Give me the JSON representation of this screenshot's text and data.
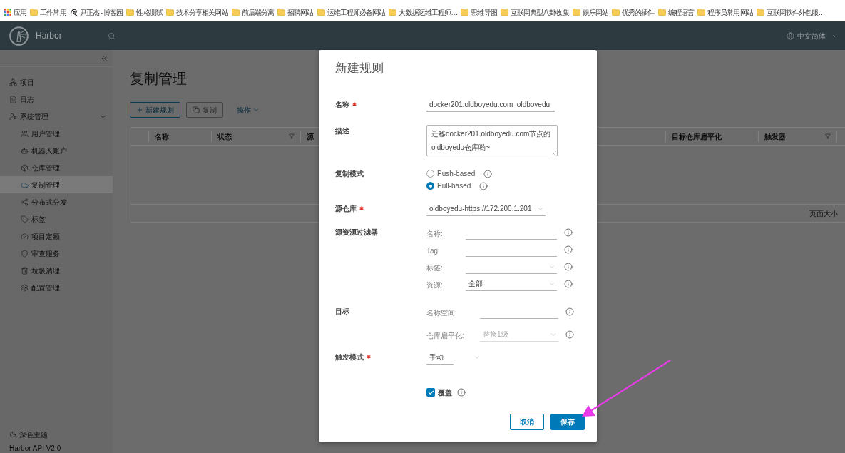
{
  "bookmarks": [
    {
      "label": "应用",
      "kind": "apps"
    },
    {
      "label": "工作常用",
      "kind": "folder"
    },
    {
      "label": "尹正杰 - 博客园",
      "kind": "site"
    },
    {
      "label": "性格测试",
      "kind": "folder"
    },
    {
      "label": "技术分享相关网站",
      "kind": "folder"
    },
    {
      "label": "前后端分离",
      "kind": "folder"
    },
    {
      "label": "招聘网站",
      "kind": "folder"
    },
    {
      "label": "运维工程师必备网站",
      "kind": "folder"
    },
    {
      "label": "大数据运维工程师…",
      "kind": "folder"
    },
    {
      "label": "思维导图",
      "kind": "folder"
    },
    {
      "label": "互联网典型八卦收集",
      "kind": "folder"
    },
    {
      "label": "娱乐网站",
      "kind": "folder"
    },
    {
      "label": "优秀的插件",
      "kind": "folder"
    },
    {
      "label": "编程语言",
      "kind": "folder"
    },
    {
      "label": "程序员常用网站",
      "kind": "folder"
    },
    {
      "label": "互联网软件外包服…",
      "kind": "folder"
    }
  ],
  "header": {
    "brand": "Harbor",
    "language": "中文简体"
  },
  "sidebar": {
    "items": [
      {
        "label": "项目",
        "selected": false
      },
      {
        "label": "日志",
        "selected": false
      },
      {
        "label": "系统管理",
        "selected": false,
        "expanded": true,
        "children": [
          {
            "label": "用户管理",
            "selected": false
          },
          {
            "label": "机器人账户",
            "selected": false
          },
          {
            "label": "仓库管理",
            "selected": false
          },
          {
            "label": "复制管理",
            "selected": true
          },
          {
            "label": "分布式分发",
            "selected": false
          },
          {
            "label": "标签",
            "selected": false
          },
          {
            "label": "项目定额",
            "selected": false
          },
          {
            "label": "审查服务",
            "selected": false
          },
          {
            "label": "垃圾清理",
            "selected": false
          },
          {
            "label": "配置管理",
            "selected": false
          }
        ]
      }
    ],
    "footer": [
      {
        "label": "深色主题"
      },
      {
        "label": "Harbor API V2.0"
      }
    ]
  },
  "page": {
    "title": "复制管理",
    "toolbar": [
      {
        "label": "新建规则",
        "kind": "new",
        "disabled": false
      },
      {
        "label": "复制",
        "kind": "replicate",
        "disabled": true
      },
      {
        "label": "操作",
        "kind": "menu",
        "disabled": false
      }
    ],
    "table": {
      "columns": [
        {
          "label": "名称",
          "filter": false
        },
        {
          "label": "状态",
          "filter": true
        },
        {
          "label": "源",
          "filter": false
        },
        {
          "label": "目标仓库扁平化",
          "filter": false
        },
        {
          "label": "触发器",
          "filter": true
        }
      ],
      "footer": "页面大小"
    }
  },
  "dialog": {
    "title": "新建规则",
    "fields": [
      {
        "kind": "input",
        "label": "名称",
        "required": true,
        "value": "docker201.oldboyedu.com_oldboyedu"
      },
      {
        "kind": "textarea",
        "label": "描述",
        "required": false,
        "value": "迁移docker201.oldboyedu.com节点的oldboyedu仓库哟~"
      },
      {
        "kind": "radio",
        "label": "复制模式",
        "required": false,
        "options": [
          {
            "label": "Push-based",
            "selected": false
          },
          {
            "label": "Pull-based",
            "selected": true
          }
        ]
      },
      {
        "kind": "select",
        "label": "源仓库",
        "required": true,
        "value": "oldboyedu-https://172.200.1.201"
      },
      {
        "kind": "group",
        "label": "源资源过滤器",
        "required": false,
        "items": [
          {
            "kind": "input",
            "label": "名称:",
            "disabled": false
          },
          {
            "kind": "input",
            "label": "Tag:",
            "disabled": false
          },
          {
            "kind": "select",
            "label": "标签:",
            "disabled": false
          },
          {
            "kind": "select",
            "label": "资源:",
            "value": "全部",
            "disabled": false
          }
        ]
      },
      {
        "kind": "group",
        "label": "目标",
        "required": false,
        "items": [
          {
            "kind": "input",
            "label": "名称空间:",
            "disabled": false
          },
          {
            "kind": "select",
            "label": "仓库扁平化:",
            "value": "替换1级",
            "disabled": true
          }
        ]
      },
      {
        "kind": "short-select",
        "label": "触发模式",
        "required": true,
        "value": "手动"
      }
    ],
    "override": {
      "label": "覆盖",
      "checked": true
    },
    "buttons": [
      {
        "label": "取消",
        "kind": "secondary"
      },
      {
        "label": "保存",
        "kind": "primary"
      }
    ]
  }
}
